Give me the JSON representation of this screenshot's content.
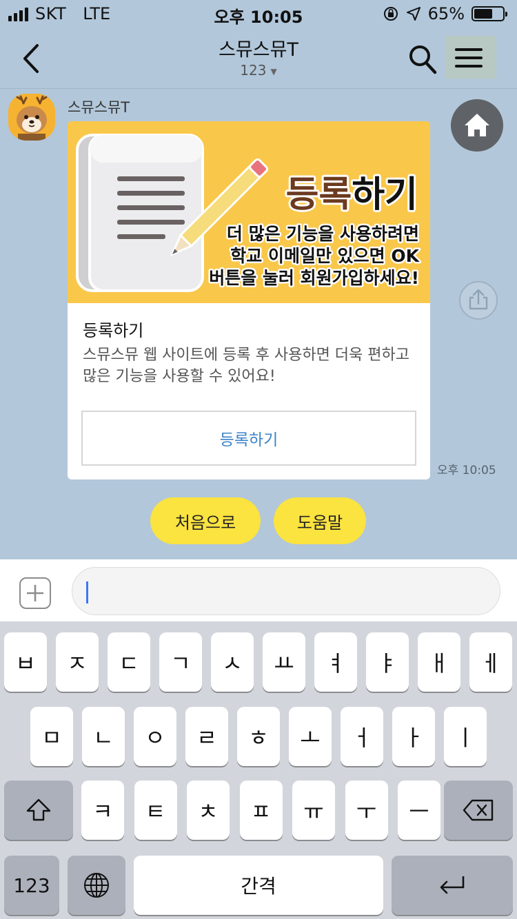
{
  "status_bar": {
    "carrier": "SKT",
    "network": "LTE",
    "time": "오후 10:05",
    "battery": "65%",
    "battery_level": 0.65
  },
  "header": {
    "title": "스뮤스뮤T",
    "member_count": "123"
  },
  "message": {
    "sender": "스뮤스뮤T",
    "time": "오후 10:05",
    "card": {
      "banner": {
        "headline_strong": "등록",
        "headline_rest": "하기",
        "line1": "더 많은 기능을 사용하려면",
        "line2": "학교 이메일만 있으면 OK",
        "line3": "버튼을 눌러 회원가입하세요!"
      },
      "title": "등록하기",
      "description": "스뮤스뮤 웹 사이트에 등록 후 사용하면 더욱 편하고 많은 기능을 사용할 수 있어요!",
      "button_label": "등록하기"
    }
  },
  "quick_replies": [
    "처음으로",
    "도움말"
  ],
  "input": {
    "placeholder": ""
  },
  "keyboard": {
    "row1": [
      "ㅂ",
      "ㅈ",
      "ㄷ",
      "ㄱ",
      "ㅅ",
      "ㅛ",
      "ㅕ",
      "ㅑ",
      "ㅐ",
      "ㅔ"
    ],
    "row2": [
      "ㅁ",
      "ㄴ",
      "ㅇ",
      "ㄹ",
      "ㅎ",
      "ㅗ",
      "ㅓ",
      "ㅏ",
      "ㅣ"
    ],
    "row3": [
      "ㅋ",
      "ㅌ",
      "ㅊ",
      "ㅍ",
      "ㅠ",
      "ㅜ",
      "ㅡ"
    ],
    "numbers_label": "123",
    "space_label": "간격",
    "icons": {
      "shift": "shift-icon",
      "backspace": "backspace-icon",
      "globe": "globe-icon",
      "return": "return-icon"
    }
  },
  "colors": {
    "chat_background": "#b2c7da",
    "banner_background": "#f9c74a",
    "quick_reply": "#fbe340",
    "link_blue": "#3a83c9",
    "headline_brown": "#6b3a1f"
  }
}
